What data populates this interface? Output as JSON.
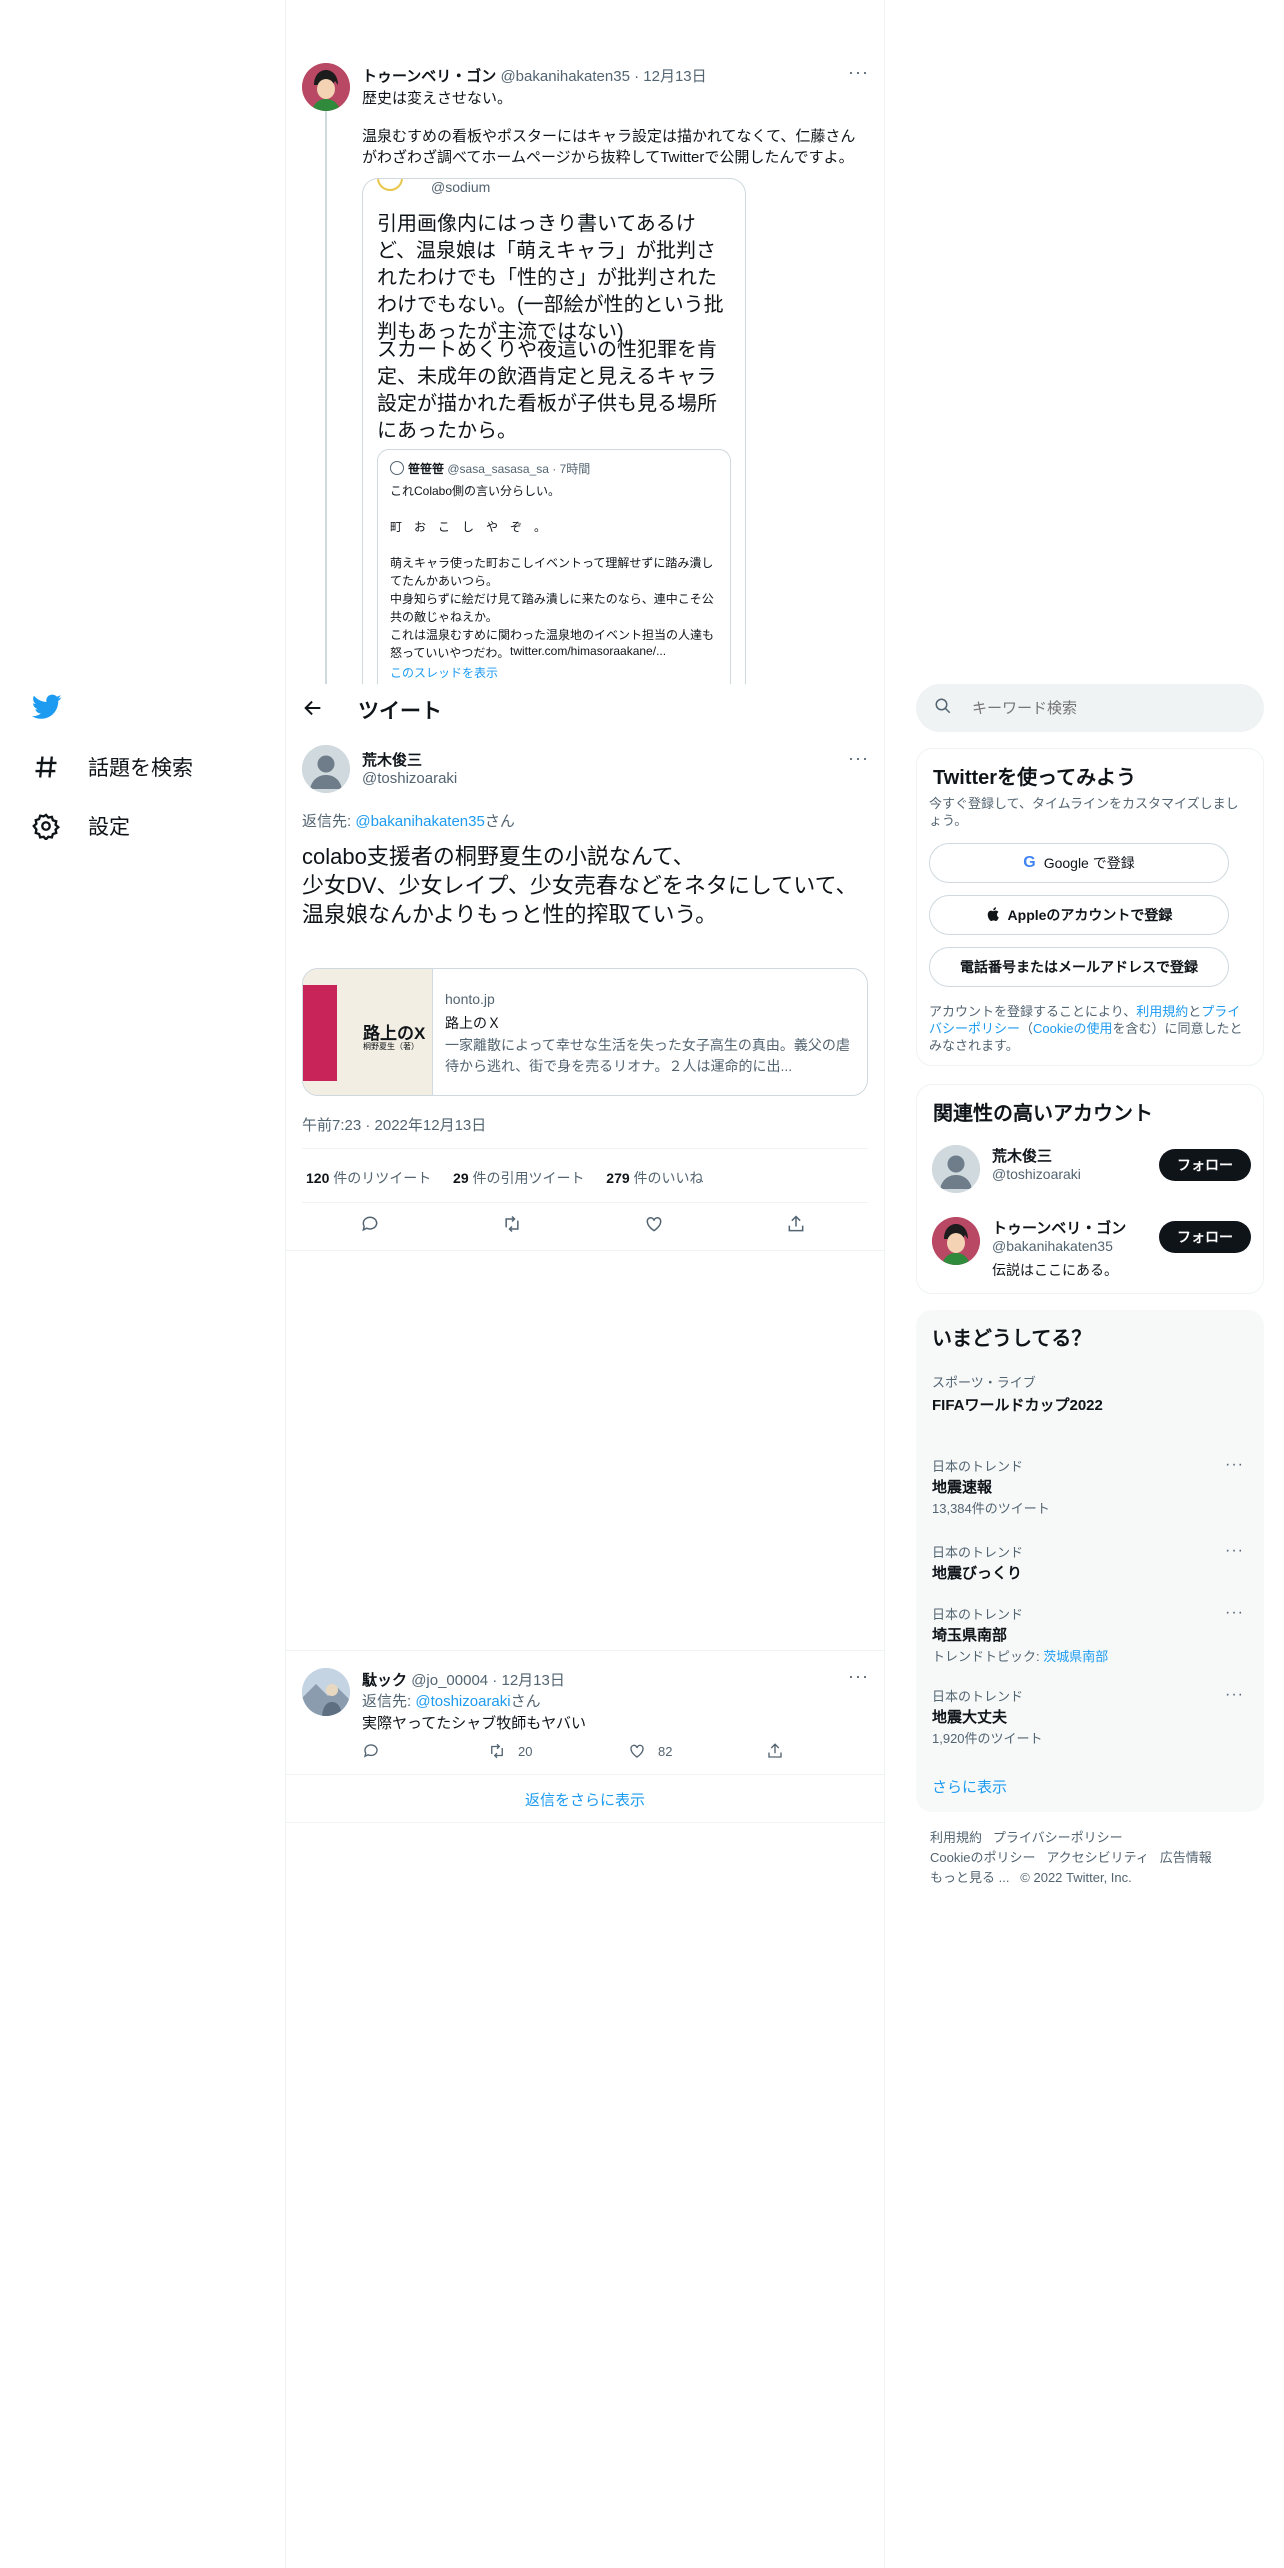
{
  "nav": {
    "explore_label": "話題を検索",
    "settings_label": "設定"
  },
  "header": {
    "title": "ツイート"
  },
  "parent_tweet": {
    "name": "トゥーンベリ・ゴン",
    "meta": "@bakanihakaten35 · 12月13日",
    "line1": "歴史は変えさせない。",
    "line2": "温泉むすめの看板やポスターにはキャラ設定は描かれてなくて、仁藤さんがわざわざ調べてホームページから抜粋してTwitterで公開したんですよ。",
    "quote": {
      "handle": "@sodium",
      "text1": "引用画像内にはっきり書いてあるけど、温泉娘は「萌えキャラ」が批判されたわけでも「性的さ」が批判されたわけでもない。(一部絵が性的という批判もあったが主流ではない)",
      "text2": "スカートめくりや夜這いの性犯罪を肯定、未成年の飲酒肯定と見えるキャラ設定が描かれた看板が子供も見る場所にあったから。",
      "inner": {
        "name": "笹笹笹",
        "meta": "@sasa_sasasa_sa · 7時間",
        "l1": "これColabo側の言い分らしい。",
        "l2": "町　お　こ　し　や　ぞ　。",
        "l3": "萌えキャラ使った町おこしイベントって理解せずに踏み潰してたんかあいつら。",
        "l4": "中身知らずに絵だけ見て踏み潰しに来たのなら、連中こそ公共の敵じゃねえか。",
        "l5": "これは温泉むすめに関わった温泉地のイベント担当の人達も怒っていいやつだわ。",
        "url": "twitter.com/himasoraakane/...",
        "show_thread": "このスレッドを表示"
      }
    }
  },
  "main_tweet": {
    "name": "荒木俊三",
    "handle": "@toshizoaraki",
    "reply_prefix": "返信先: ",
    "reply_to": "@bakanihakaten35",
    "reply_suffix": "さん",
    "line1": "colabo支援者の桐野夏生の小説なんて、",
    "line2": "少女DV、少女レイプ、少女売春などをネタにしていて、",
    "line3": "温泉娘なんかよりもっと性的搾取ていう。",
    "card": {
      "thumb_title": "路上のX",
      "thumb_author": "桐野夏生（著）",
      "domain": "honto.jp",
      "title": "路上のＸ",
      "desc": "一家離散によって幸せな生活を失った女子高生の真由。義父の虐待から逃れ、街で身を売るリオナ。２人は運命的に出..."
    },
    "timestamp": "午前7:23 · 2022年12月13日",
    "stats": {
      "retweets_num": "120",
      "retweets_label": " 件のリツイート",
      "quotes_num": "29",
      "quotes_label": " 件の引用ツイート",
      "likes_num": "279",
      "likes_label": " 件のいいね"
    }
  },
  "reply_tweet": {
    "name": "駄ック",
    "meta": "@jo_00004 · 12月13日",
    "reply_prefix": "返信先: ",
    "reply_to": "@toshizoaraki",
    "reply_suffix": "さん",
    "text": "実際ヤってたシャブ牧師もヤバい",
    "retweets": "20",
    "likes": "82"
  },
  "show_more_replies": "返信をさらに表示",
  "search": {
    "placeholder": "キーワード検索"
  },
  "signup": {
    "title": "Twitterを使ってみよう",
    "subtitle": "今すぐ登録して、タイムラインをカスタマイズしましょう。",
    "google": "Google で登録",
    "apple": "Appleのアカウントで登録",
    "email": "電話番号またはメールアドレスで登録",
    "legal1": "アカウントを登録することにより、",
    "legal_terms": "利用規約",
    "legal_and": "と",
    "legal_privacy": "プライバシーポリシー",
    "legal2": "（",
    "legal_cookie": "Cookieの使用",
    "legal3": "を含む）に同意したとみなされます。"
  },
  "relevant": {
    "title": "関連性の高いアカウント",
    "follow_label": "フォロー",
    "accounts": [
      {
        "name": "荒木俊三",
        "handle": "@toshizoaraki",
        "bio": ""
      },
      {
        "name": "トゥーンベリ・ゴン",
        "handle": "@bakanihakaten35",
        "bio": "伝説はここにある。"
      }
    ]
  },
  "trends": {
    "title": "いまどうしてる？",
    "event": {
      "category": "スポーツ・ライブ",
      "name": "FIFAワールドカップ2022"
    },
    "items": [
      {
        "context": "日本のトレンド",
        "name": "地震速報",
        "count": "13,384件のツイート"
      },
      {
        "context": "日本のトレンド",
        "name": "地震びっくり",
        "count": ""
      },
      {
        "context": "日本のトレンド",
        "name": "埼玉県南部",
        "count_prefix": "トレンドトピック: ",
        "count_link": "茨城県南部"
      },
      {
        "context": "日本のトレンド",
        "name": "地震大丈夫",
        "count": "1,920件のツイート"
      }
    ],
    "show_more": "さらに表示"
  },
  "footer": {
    "terms": "利用規約",
    "privacy": "プライバシーポリシー",
    "cookie": "Cookieのポリシー",
    "accessibility": "アクセシビリティ",
    "ads": "広告情報",
    "more": "もっと見る ...",
    "copyright": "© 2022 Twitter, Inc."
  },
  "colors": {
    "accent": "#1d9bf0",
    "text": "#0f1419",
    "muted": "#536471",
    "border": "#eff3f4"
  }
}
